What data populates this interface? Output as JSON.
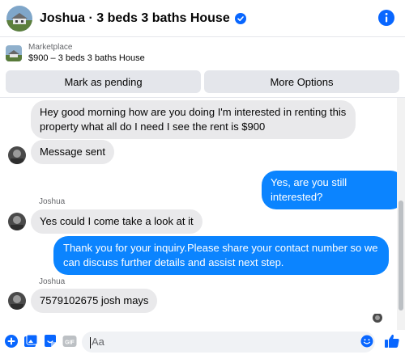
{
  "header": {
    "title": "Joshua · 3 beds 3 baths House",
    "avatar_icon": "house-photo-avatar",
    "verified_icon": "verified-badge-icon",
    "info_icon": "info-icon",
    "accent": "#0866ff"
  },
  "listing": {
    "kicker": "Marketplace",
    "title": "$900 – 3 beds 3 baths House"
  },
  "actions": {
    "mark_pending": "Mark as pending",
    "more_options": "More Options"
  },
  "messages": [
    {
      "from": "in",
      "text": "Hey good morning how are you doing I'm interested in renting this property what all do I need I see the rent is $900"
    },
    {
      "from": "in",
      "text": "Message sent"
    },
    {
      "from": "out",
      "text": "Yes, are you still interested?"
    },
    {
      "from": "in",
      "sender": "Joshua",
      "text": "Yes could I come take a look at it"
    },
    {
      "from": "out",
      "text": "Thank you for your inquiry.Please share your contact number so we can discuss further details and assist next step."
    },
    {
      "from": "in",
      "sender": "Joshua",
      "text": "7579102675 josh mays"
    }
  ],
  "composer": {
    "placeholder": "Aa",
    "icons": [
      "plus-icon",
      "photo-icon",
      "sticker-icon",
      "gif-icon",
      "emoji-icon",
      "thumbs-up-icon"
    ]
  },
  "colors": {
    "outgoing_bubble": "#0b84ff",
    "incoming_bubble": "#e9e9eb",
    "brand_blue": "#0866ff"
  }
}
